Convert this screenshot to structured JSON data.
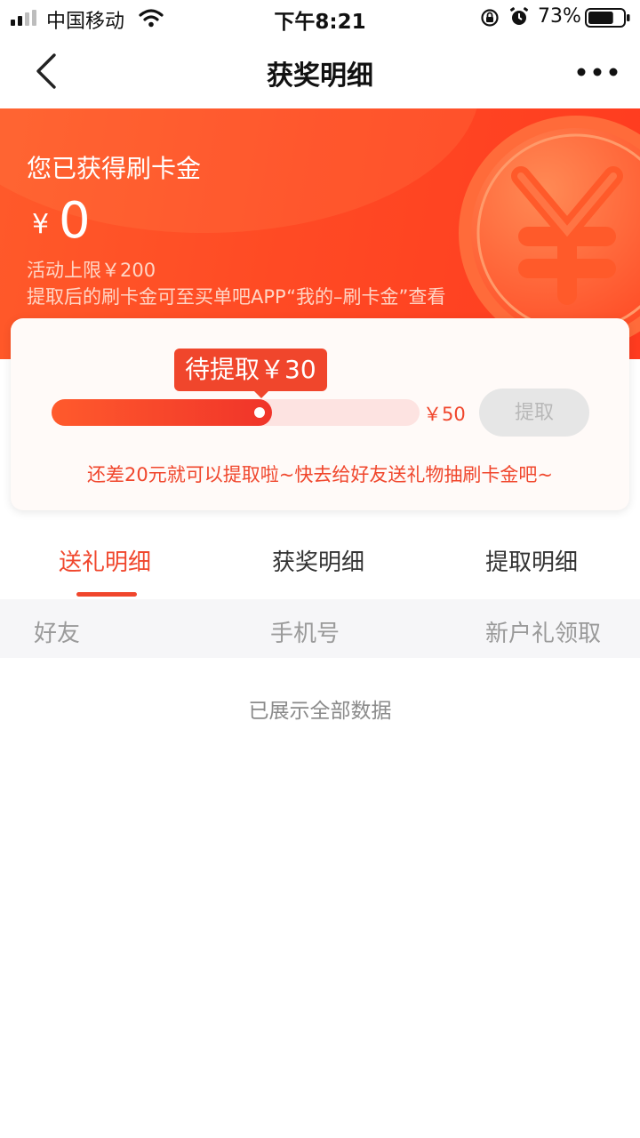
{
  "status_bar": {
    "carrier": "中国移动",
    "time": "下午8:21",
    "battery": "73%",
    "battery_level": 0.73,
    "icons": [
      "signal-icon",
      "wifi-icon",
      "rotation-lock-icon",
      "alarm-icon",
      "battery-icon"
    ]
  },
  "nav": {
    "title": "获奖明细",
    "back_icon": "chevron-left-icon",
    "more_icon": "more-dots-icon"
  },
  "banner": {
    "title": "您已获得刷卡金",
    "currency": "¥",
    "amount": "0",
    "limit": "活动上限￥200",
    "note": "提取后的刷卡金可至买单吧APP“我的–刷卡金”查看",
    "icon": "yuan-coin-icon"
  },
  "progress": {
    "pending_label": "待提取￥30",
    "max_label": "￥50",
    "current": 30,
    "max": 50,
    "withdraw_button": "提取",
    "hint": "还差20元就可以提取啦~快去给好友送礼物抽刷卡金吧~"
  },
  "tabs": [
    {
      "label": "送礼明细",
      "active": true
    },
    {
      "label": "获奖明细",
      "active": false
    },
    {
      "label": "提取明细",
      "active": false
    }
  ],
  "table": {
    "columns": [
      "好友",
      "手机号",
      "新户礼领取"
    ],
    "empty_text": "已展示全部数据"
  },
  "colors": {
    "accent": "#f0462c",
    "banner": "#ff4a24",
    "disabled_button": "#e6e6e6"
  }
}
